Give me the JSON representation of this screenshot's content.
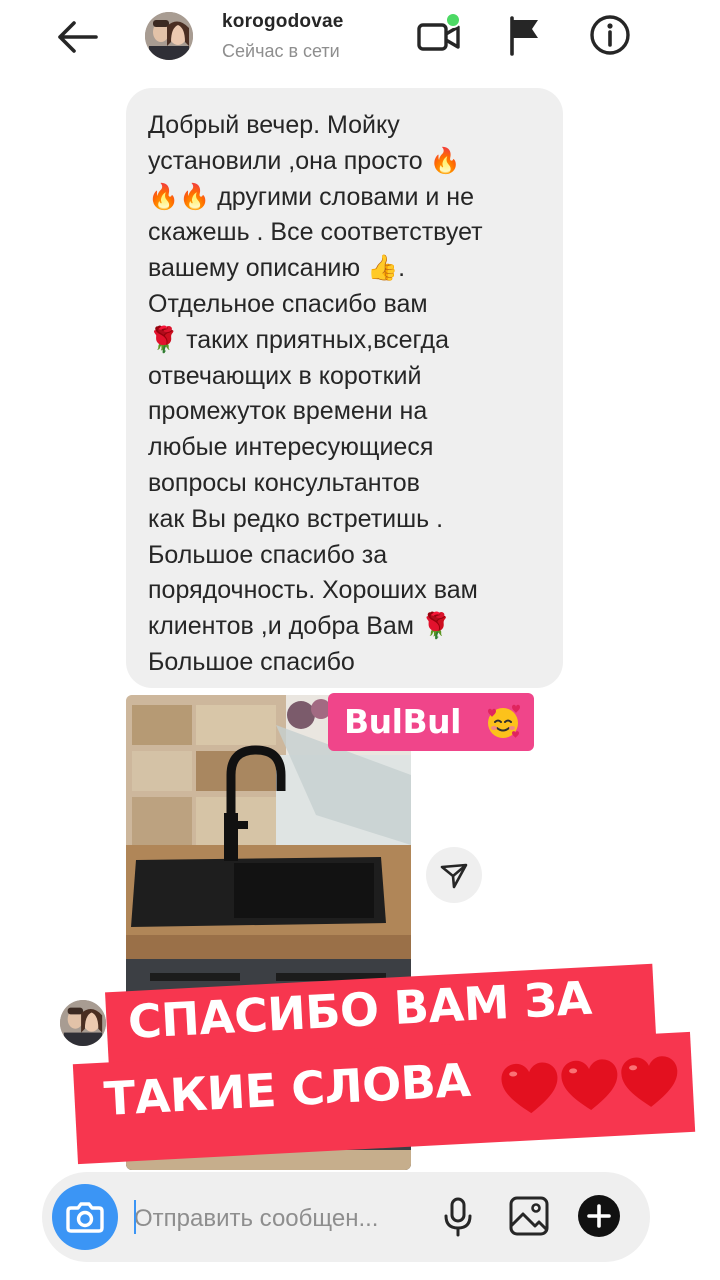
{
  "header": {
    "username": "korogodovae",
    "status": "Сейчас в сети"
  },
  "message": {
    "text": "Добрый вечер. Мойку\nустановили ,она просто 🔥\n🔥🔥 другими словами и не\nскажешь . Все соответствует\nвашему описанию 👍.\nОтдельное спасибо вам\n🌹 таких приятных,всегда\nотвечающих в короткий\nпромежуток времени на\nлюбые интересующиеся\nвопросы консультантов\nкак Вы редко встретишь .\nБольшое спасибо за\nпорядочность. Хороших вам\nклиентов ,и добра Вам 🌹\nБольшое спасибо"
  },
  "sticker": {
    "text": "BulBul",
    "emoji_icon": "smiling-face-with-hearts-icon"
  },
  "overlay": {
    "line1": "СПАСИБО ВАМ ЗА",
    "line2": "ТАКИЕ СЛОВА",
    "hearts_icon": "red-heart-icon",
    "hearts_count": 3,
    "banner_color": "#f7364f"
  },
  "composer": {
    "placeholder": "Отправить сообщен..."
  },
  "colors": {
    "accent_blue": "#3b95f5",
    "online_green": "#4cd964",
    "sticker_pink": "#f0458a"
  }
}
